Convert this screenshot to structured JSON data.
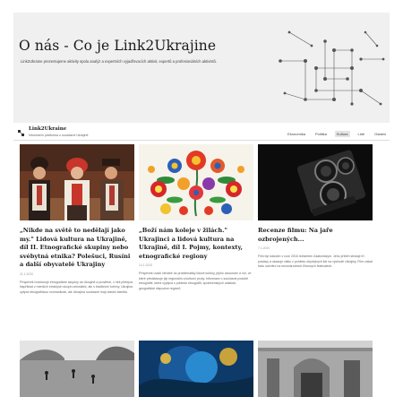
{
  "hero": {
    "title": "O nás - Co je Link2Ukrajine",
    "subtitle": "Link2Ukraine prezentujeme aktivity spolu analýz a expertních vyjadřovacích aktivit, expertů a profesionálních aktivistů."
  },
  "nav": {
    "logo_text": "Link2Ukraine",
    "logo_tagline": "Informační platforma o současné Ukrajině",
    "menu": [
      "Ekonomika",
      "Politika",
      "Kultura",
      "Lidé",
      "Ostatní"
    ],
    "active_index": 2
  },
  "cards": [
    {
      "title": "„Nikde na světě to nedělají jako my.\" Lidová kultura na Ukrajině, díl II. Etnografické skupiny nebo svébytná etnika? Polešuci, Rusíni a další obyvatelé Ukrajiny",
      "date": "21.1.2020",
      "excerpt": "Příspěvek monitoruje etnografické skupiny na Ukrajině a prostředí, v něž přebývá. Například z menších etnických skupin celostátní, ale s tradičními kořeny. Ukrajina oplývá etnografickou rozmanitostí, ale Ukrajinci současně mají vlastní identitu."
    },
    {
      "title": "„Boží nám koleje v žilách.\" Ukrajinci a lidová kultura na Ukrajině, díl I. Pojmy, kontexty, etnografické regiony",
      "date": "14.1.2020",
      "excerpt": "Příspěvek uvádí čtenáře do problematiky lidové kultury, jejího zkoumání a rolí, ve které představuje její regionální a kulturní prvky. Informace o současné podobě etnografie, která vyplývá z pohledu etnografů, společenských událostí, geografické dispozice regionů."
    },
    {
      "title": "Recenze filmu: Na jaře ozbrojených...",
      "date": "7.1.2020",
      "excerpt": "Film byl natočen v roce 2016 režisérem Zaatomskym. Jeho příběh sleduje tři postavy a ukazuje válku z pohledu obyčejných lidí na východě Ukrajiny. Film získal řadu ocenění na mezinárodních filmových festivalech."
    }
  ]
}
